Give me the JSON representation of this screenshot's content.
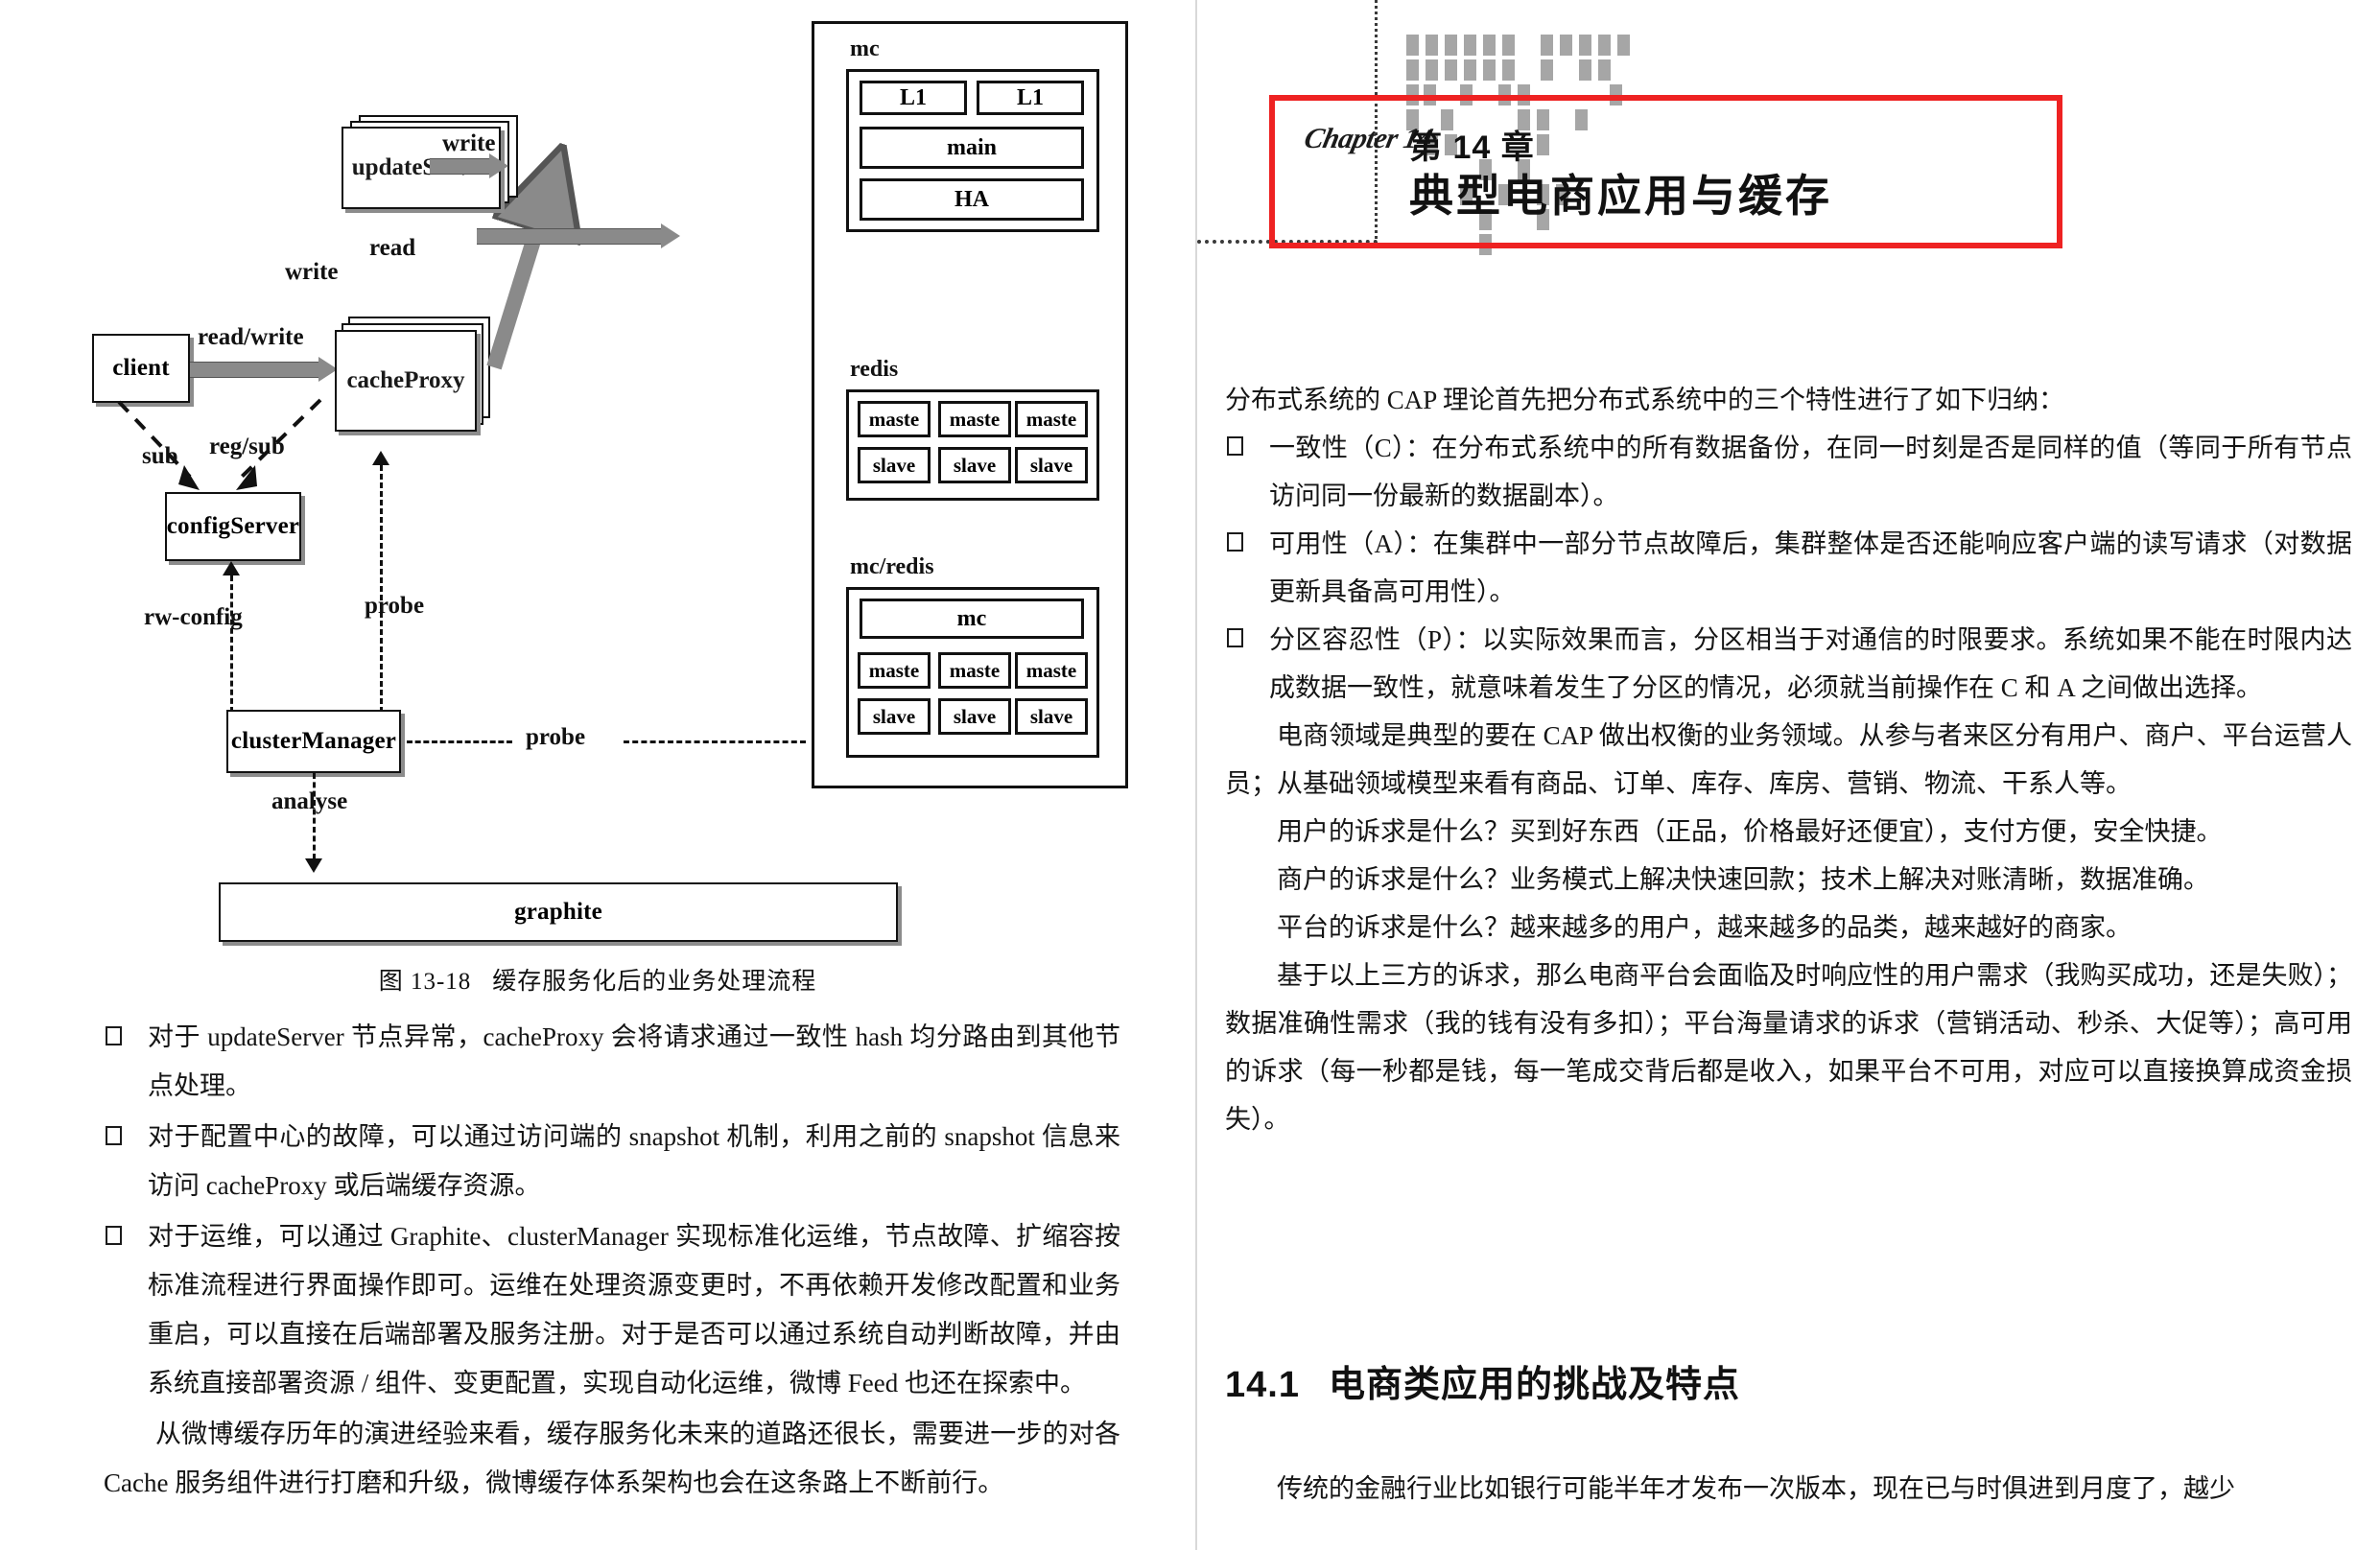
{
  "left_page": {
    "figure": {
      "caption_label": "图 13-18",
      "caption_text": "缓存服务化后的业务处理流程",
      "nodes": {
        "client": "client",
        "cache_proxy": "cacheProxy",
        "update_server": "updateServer",
        "config_server": "configServer",
        "cluster_manager": "clusterManager",
        "graphite": "graphite"
      },
      "edges": {
        "read_write": "read/write",
        "write_to_update": "write",
        "write_to_mc": "write",
        "read": "read",
        "sub": "sub",
        "reg_sub": "reg/sub",
        "rw_config": "rw-config",
        "probe_proxy": "probe",
        "probe_backend": "probe",
        "analyse": "analyse"
      },
      "backend": {
        "groups": [
          {
            "title": "mc",
            "rows": [
              [
                "L1",
                "L1"
              ],
              [
                "main"
              ],
              [
                "HA"
              ]
            ]
          },
          {
            "title": "redis",
            "rows": [
              [
                "maste",
                "maste",
                "maste"
              ],
              [
                "slave",
                "slave",
                "slave"
              ]
            ]
          },
          {
            "title": "mc/redis",
            "rows": [
              [
                "mc"
              ],
              [
                "maste",
                "maste",
                "maste"
              ],
              [
                "slave",
                "slave",
                "slave"
              ]
            ]
          }
        ]
      }
    },
    "bullets": [
      "对于 updateServer 节点异常，cacheProxy 会将请求通过一致性 hash 均分路由到其他节点处理。",
      "对于配置中心的故障，可以通过访问端的 snapshot 机制，利用之前的 snapshot 信息来访问 cacheProxy 或后端缓存资源。",
      "对于运维，可以通过 Graphite、clusterManager 实现标准化运维，节点故障、扩缩容按标准流程进行界面操作即可。运维在处理资源变更时，不再依赖开发修改配置和业务重启，可以直接在后端部署及服务注册。对于是否可以通过系统自动判断故障，并由系统直接部署资源 / 组件、变更配置，实现自动化运维，微博 Feed 也还在探索中。"
    ],
    "closing_paragraph": "从微博缓存历年的演进经验来看，缓存服务化未来的道路还很长，需要进一步的对各 Cache 服务组件进行打磨和升级，微博缓存体系架构也会在这条路上不断前行。"
  },
  "right_page": {
    "chapter_script": "Chapter 14",
    "chapter_number": "第 14 章",
    "chapter_title": "典型电商应用与缓存",
    "accent_color": "#ee2222",
    "intro": "分布式系统的 CAP 理论首先把分布式系统中的三个特性进行了如下归纳：",
    "cap_bullets": [
      "一致性（C）：在分布式系统中的所有数据备份，在同一时刻是否是同样的值（等同于所有节点访问同一份最新的数据副本）。",
      "可用性（A）：在集群中一部分节点故障后，集群整体是否还能响应客户端的读写请求（对数据更新具备高可用性）。",
      "分区容忍性（P）：以实际效果而言，分区相当于对通信的时限要求。系统如果不能在时限内达成数据一致性，就意味着发生了分区的情况，必须就当前操作在 C 和 A 之间做出选择。"
    ],
    "paragraphs": [
      "电商领域是典型的要在 CAP 做出权衡的业务领域。从参与者来区分有用户、商户、平台运营人员；从基础领域模型来看有商品、订单、库存、库房、营销、物流、干系人等。",
      "用户的诉求是什么？买到好东西（正品，价格最好还便宜），支付方便，安全快捷。",
      "商户的诉求是什么？业务模式上解决快速回款；技术上解决对账清晰，数据准确。",
      "平台的诉求是什么？越来越多的用户，越来越多的品类，越来越好的商家。",
      "基于以上三方的诉求，那么电商平台会面临及时响应性的用户需求（我购买成功，还是失败）；数据准确性需求（我的钱有没有多扣）；平台海量请求的诉求（营销活动、秒杀、大促等）；高可用的诉求（每一秒都是钱，每一笔成交背后都是收入，如果平台不可用，对应可以直接换算成资金损失）。"
    ],
    "section": {
      "number": "14.1",
      "title": "电商类应用的挑战及特点"
    },
    "section_paragraph": "传统的金融行业比如银行可能半年才发布一次版本，现在已与时俱进到月度了，越少"
  }
}
